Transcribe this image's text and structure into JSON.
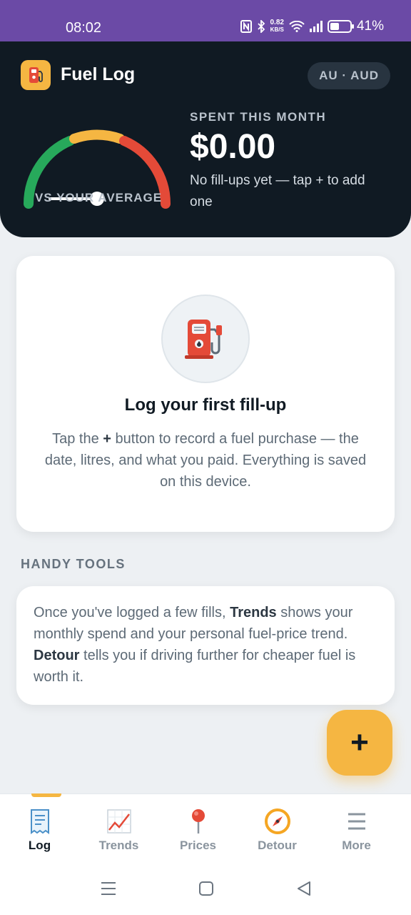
{
  "status_bar": {
    "time": "08:02",
    "speed_value": "0.82",
    "speed_unit": "KB/S",
    "battery": "41%",
    "icons": [
      "nfc-icon",
      "bluetooth-icon",
      "wifi-icon",
      "signal-icon",
      "battery-icon"
    ]
  },
  "header": {
    "app_title": "Fuel Log",
    "region": "AU · AUD",
    "gauge_label": "VS YOUR AVERAGE",
    "spent_label": "SPENT THIS MONTH",
    "spent_amount": "$0.00",
    "spent_note": "No fill-ups yet — tap + to add one",
    "gauge_colors": [
      "#27a95b",
      "#f5b642",
      "#e44a38"
    ]
  },
  "empty_state": {
    "title": "Log your first fill-up",
    "body_pre": "Tap the ",
    "body_bold": "+",
    "body_post": " button to record a fuel purchase — the date, litres, and what you paid. Everything is saved on this device."
  },
  "tools": {
    "section_title": "HANDY TOOLS",
    "text_1": "Once you've logged a few fills, ",
    "bold_1": "Trends",
    "text_2": " shows your monthly spend and your personal fuel-price trend. ",
    "bold_2": "Detour",
    "text_3": " tells you if driving further for cheaper fuel is worth it."
  },
  "fab": {
    "label": "+"
  },
  "nav": {
    "items": [
      {
        "label": "Log",
        "icon": "receipt-icon"
      },
      {
        "label": "Trends",
        "icon": "chart-icon"
      },
      {
        "label": "Prices",
        "icon": "pin-icon"
      },
      {
        "label": "Detour",
        "icon": "compass-icon"
      },
      {
        "label": "More",
        "icon": "menu-icon"
      }
    ]
  },
  "colors": {
    "accent": "#f5b642",
    "header_bg": "#101a23",
    "status_bar": "#6b4aa6"
  }
}
